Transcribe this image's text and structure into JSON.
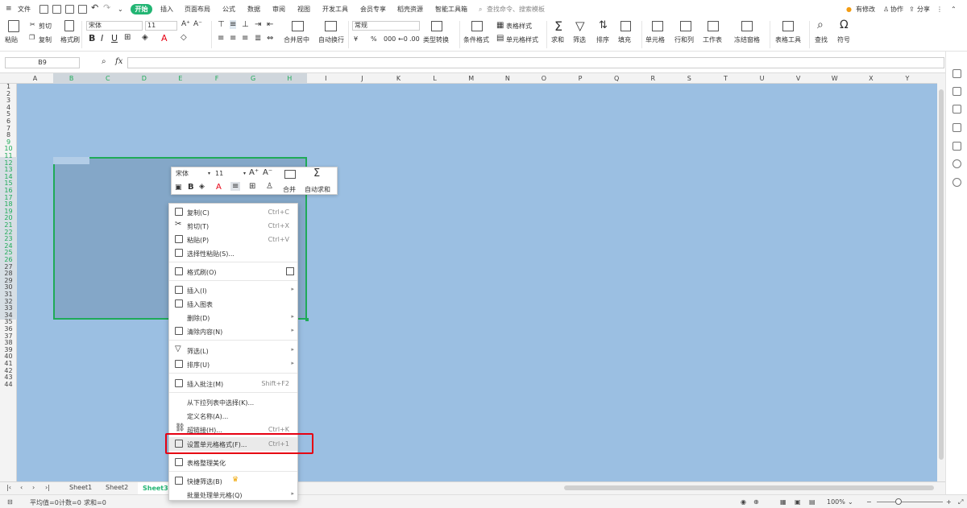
{
  "menubar": {
    "file": "文件",
    "tabs": [
      "开始",
      "插入",
      "页面布局",
      "公式",
      "数据",
      "审阅",
      "视图",
      "开发工具",
      "会员专享",
      "稻壳资源",
      "智能工具箱"
    ],
    "search": "查找命令、搜索模板",
    "right": [
      "有修改",
      "协作",
      "分享"
    ]
  },
  "ribbon": {
    "paste": "粘贴",
    "cut": "剪切",
    "copy": "复制",
    "format_painter": "格式刷",
    "font": "宋体",
    "size": "11",
    "merge": "合并居中",
    "wrap": "自动换行",
    "numfmt": "常规",
    "type_convert": "类型转换",
    "cond_fmt": "条件格式",
    "table_style": "表格样式",
    "cell_style": "单元格样式",
    "sum": "求和",
    "filter": "筛选",
    "sort": "排序",
    "fill": "填充",
    "cells": "单元格",
    "rowcol": "行和列",
    "sheet": "工作表",
    "freeze": "冻结窗格",
    "table_tools": "表格工具",
    "find": "查找",
    "symbol": "符号",
    "percent": "%",
    "thousands": "000",
    "currency": "¥"
  },
  "formulabar": {
    "namebox": "B9",
    "fx": "fx"
  },
  "columns": [
    "A",
    "B",
    "C",
    "D",
    "E",
    "F",
    "G",
    "H",
    "I",
    "J",
    "K",
    "L",
    "M",
    "N",
    "O",
    "P",
    "Q",
    "R",
    "S",
    "T",
    "U",
    "V",
    "W",
    "X",
    "Y"
  ],
  "rows": [
    "1",
    "2",
    "3",
    "4",
    "5",
    "6",
    "7",
    "8",
    "9",
    "10",
    "11",
    "12",
    "13",
    "14",
    "15",
    "16",
    "17",
    "18",
    "19",
    "20",
    "21",
    "22",
    "23",
    "24",
    "25",
    "26",
    "27",
    "28",
    "29",
    "30",
    "31",
    "32",
    "33",
    "34",
    "35",
    "36",
    "37",
    "38",
    "39",
    "40",
    "41",
    "42",
    "43",
    "44"
  ],
  "minitoolbar": {
    "font": "宋体",
    "size": "11",
    "merge": "合并",
    "autosum": "自动求和"
  },
  "context_menu": [
    {
      "label": "复制(C)",
      "shortcut": "Ctrl+C",
      "icon": "copy-icon"
    },
    {
      "label": "剪切(T)",
      "shortcut": "Ctrl+X",
      "icon": "scissors-icon"
    },
    {
      "label": "粘贴(P)",
      "shortcut": "Ctrl+V",
      "icon": "paste-icon"
    },
    {
      "label": "选择性粘贴(S)...",
      "shortcut": "",
      "icon": "paste-special-icon"
    },
    {
      "label": "格式刷(O)",
      "shortcut": "",
      "icon": "format-painter-icon"
    },
    {
      "label": "插入(I)",
      "shortcut": "",
      "icon": "insert-icon"
    },
    {
      "label": "插入图表",
      "shortcut": "",
      "icon": "chart-icon"
    },
    {
      "label": "删除(D)",
      "shortcut": "",
      "icon": ""
    },
    {
      "label": "清除内容(N)",
      "shortcut": "",
      "icon": "eraser-icon"
    },
    {
      "label": "筛选(L)",
      "shortcut": "",
      "icon": "filter-icon"
    },
    {
      "label": "排序(U)",
      "shortcut": "",
      "icon": "sort-icon"
    },
    {
      "label": "插入批注(M)",
      "shortcut": "Shift+F2",
      "icon": "comment-icon"
    },
    {
      "label": "从下拉列表中选择(K)...",
      "shortcut": "",
      "icon": ""
    },
    {
      "label": "定义名称(A)...",
      "shortcut": "",
      "icon": ""
    },
    {
      "label": "超链接(H)...",
      "shortcut": "Ctrl+K",
      "icon": "link-icon"
    },
    {
      "label": "设置单元格格式(F)...",
      "shortcut": "Ctrl+1",
      "icon": "format-cells-icon"
    },
    {
      "label": "表格整理美化",
      "shortcut": "",
      "icon": "beautify-icon"
    },
    {
      "label": "快捷筛选(B)",
      "shortcut": "",
      "icon": "quick-filter-icon"
    },
    {
      "label": "批量处理单元格(Q)",
      "shortcut": "",
      "icon": ""
    }
  ],
  "sheets": [
    "Sheet1",
    "Sheet2",
    "Sheet3"
  ],
  "active_sheet": "Sheet3",
  "status": {
    "avg": "平均值=0",
    "count": "计数=0",
    "sum": "求和=0",
    "zoom": "100%"
  },
  "colors": {
    "accent": "#22b573",
    "selection_border": "#1faa58",
    "highlight": "#e60012",
    "grid_bg": "#9bbfe2"
  }
}
